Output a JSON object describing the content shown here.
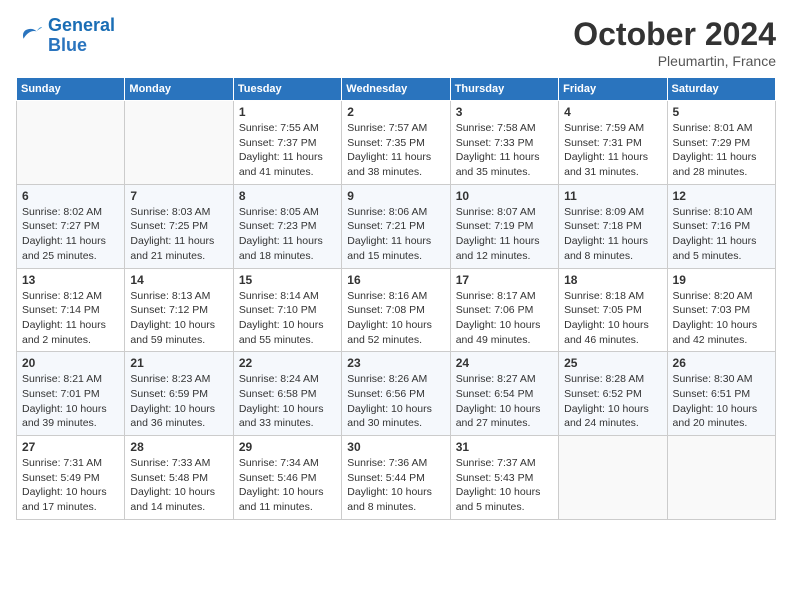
{
  "header": {
    "logo_line1": "General",
    "logo_line2": "Blue",
    "month_title": "October 2024",
    "location": "Pleumartin, France"
  },
  "weekdays": [
    "Sunday",
    "Monday",
    "Tuesday",
    "Wednesday",
    "Thursday",
    "Friday",
    "Saturday"
  ],
  "weeks": [
    [
      {
        "day": "",
        "sunrise": "",
        "sunset": "",
        "daylight": ""
      },
      {
        "day": "",
        "sunrise": "",
        "sunset": "",
        "daylight": ""
      },
      {
        "day": "1",
        "sunrise": "Sunrise: 7:55 AM",
        "sunset": "Sunset: 7:37 PM",
        "daylight": "Daylight: 11 hours and 41 minutes."
      },
      {
        "day": "2",
        "sunrise": "Sunrise: 7:57 AM",
        "sunset": "Sunset: 7:35 PM",
        "daylight": "Daylight: 11 hours and 38 minutes."
      },
      {
        "day": "3",
        "sunrise": "Sunrise: 7:58 AM",
        "sunset": "Sunset: 7:33 PM",
        "daylight": "Daylight: 11 hours and 35 minutes."
      },
      {
        "day": "4",
        "sunrise": "Sunrise: 7:59 AM",
        "sunset": "Sunset: 7:31 PM",
        "daylight": "Daylight: 11 hours and 31 minutes."
      },
      {
        "day": "5",
        "sunrise": "Sunrise: 8:01 AM",
        "sunset": "Sunset: 7:29 PM",
        "daylight": "Daylight: 11 hours and 28 minutes."
      }
    ],
    [
      {
        "day": "6",
        "sunrise": "Sunrise: 8:02 AM",
        "sunset": "Sunset: 7:27 PM",
        "daylight": "Daylight: 11 hours and 25 minutes."
      },
      {
        "day": "7",
        "sunrise": "Sunrise: 8:03 AM",
        "sunset": "Sunset: 7:25 PM",
        "daylight": "Daylight: 11 hours and 21 minutes."
      },
      {
        "day": "8",
        "sunrise": "Sunrise: 8:05 AM",
        "sunset": "Sunset: 7:23 PM",
        "daylight": "Daylight: 11 hours and 18 minutes."
      },
      {
        "day": "9",
        "sunrise": "Sunrise: 8:06 AM",
        "sunset": "Sunset: 7:21 PM",
        "daylight": "Daylight: 11 hours and 15 minutes."
      },
      {
        "day": "10",
        "sunrise": "Sunrise: 8:07 AM",
        "sunset": "Sunset: 7:19 PM",
        "daylight": "Daylight: 11 hours and 12 minutes."
      },
      {
        "day": "11",
        "sunrise": "Sunrise: 8:09 AM",
        "sunset": "Sunset: 7:18 PM",
        "daylight": "Daylight: 11 hours and 8 minutes."
      },
      {
        "day": "12",
        "sunrise": "Sunrise: 8:10 AM",
        "sunset": "Sunset: 7:16 PM",
        "daylight": "Daylight: 11 hours and 5 minutes."
      }
    ],
    [
      {
        "day": "13",
        "sunrise": "Sunrise: 8:12 AM",
        "sunset": "Sunset: 7:14 PM",
        "daylight": "Daylight: 11 hours and 2 minutes."
      },
      {
        "day": "14",
        "sunrise": "Sunrise: 8:13 AM",
        "sunset": "Sunset: 7:12 PM",
        "daylight": "Daylight: 10 hours and 59 minutes."
      },
      {
        "day": "15",
        "sunrise": "Sunrise: 8:14 AM",
        "sunset": "Sunset: 7:10 PM",
        "daylight": "Daylight: 10 hours and 55 minutes."
      },
      {
        "day": "16",
        "sunrise": "Sunrise: 8:16 AM",
        "sunset": "Sunset: 7:08 PM",
        "daylight": "Daylight: 10 hours and 52 minutes."
      },
      {
        "day": "17",
        "sunrise": "Sunrise: 8:17 AM",
        "sunset": "Sunset: 7:06 PM",
        "daylight": "Daylight: 10 hours and 49 minutes."
      },
      {
        "day": "18",
        "sunrise": "Sunrise: 8:18 AM",
        "sunset": "Sunset: 7:05 PM",
        "daylight": "Daylight: 10 hours and 46 minutes."
      },
      {
        "day": "19",
        "sunrise": "Sunrise: 8:20 AM",
        "sunset": "Sunset: 7:03 PM",
        "daylight": "Daylight: 10 hours and 42 minutes."
      }
    ],
    [
      {
        "day": "20",
        "sunrise": "Sunrise: 8:21 AM",
        "sunset": "Sunset: 7:01 PM",
        "daylight": "Daylight: 10 hours and 39 minutes."
      },
      {
        "day": "21",
        "sunrise": "Sunrise: 8:23 AM",
        "sunset": "Sunset: 6:59 PM",
        "daylight": "Daylight: 10 hours and 36 minutes."
      },
      {
        "day": "22",
        "sunrise": "Sunrise: 8:24 AM",
        "sunset": "Sunset: 6:58 PM",
        "daylight": "Daylight: 10 hours and 33 minutes."
      },
      {
        "day": "23",
        "sunrise": "Sunrise: 8:26 AM",
        "sunset": "Sunset: 6:56 PM",
        "daylight": "Daylight: 10 hours and 30 minutes."
      },
      {
        "day": "24",
        "sunrise": "Sunrise: 8:27 AM",
        "sunset": "Sunset: 6:54 PM",
        "daylight": "Daylight: 10 hours and 27 minutes."
      },
      {
        "day": "25",
        "sunrise": "Sunrise: 8:28 AM",
        "sunset": "Sunset: 6:52 PM",
        "daylight": "Daylight: 10 hours and 24 minutes."
      },
      {
        "day": "26",
        "sunrise": "Sunrise: 8:30 AM",
        "sunset": "Sunset: 6:51 PM",
        "daylight": "Daylight: 10 hours and 20 minutes."
      }
    ],
    [
      {
        "day": "27",
        "sunrise": "Sunrise: 7:31 AM",
        "sunset": "Sunset: 5:49 PM",
        "daylight": "Daylight: 10 hours and 17 minutes."
      },
      {
        "day": "28",
        "sunrise": "Sunrise: 7:33 AM",
        "sunset": "Sunset: 5:48 PM",
        "daylight": "Daylight: 10 hours and 14 minutes."
      },
      {
        "day": "29",
        "sunrise": "Sunrise: 7:34 AM",
        "sunset": "Sunset: 5:46 PM",
        "daylight": "Daylight: 10 hours and 11 minutes."
      },
      {
        "day": "30",
        "sunrise": "Sunrise: 7:36 AM",
        "sunset": "Sunset: 5:44 PM",
        "daylight": "Daylight: 10 hours and 8 minutes."
      },
      {
        "day": "31",
        "sunrise": "Sunrise: 7:37 AM",
        "sunset": "Sunset: 5:43 PM",
        "daylight": "Daylight: 10 hours and 5 minutes."
      },
      {
        "day": "",
        "sunrise": "",
        "sunset": "",
        "daylight": ""
      },
      {
        "day": "",
        "sunrise": "",
        "sunset": "",
        "daylight": ""
      }
    ]
  ]
}
